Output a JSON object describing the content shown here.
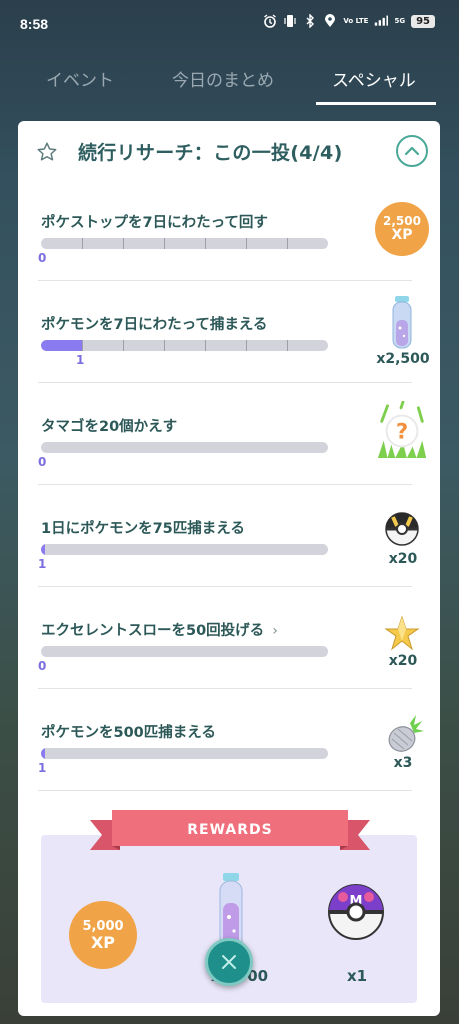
{
  "status_bar": {
    "time": "8:58",
    "battery": "95",
    "network_label": "Vo LTE",
    "signal_label": "5G"
  },
  "tabs": [
    {
      "label": "イベント",
      "active": false
    },
    {
      "label": "今日のまとめ",
      "active": false
    },
    {
      "label": "スペシャル",
      "active": true
    }
  ],
  "card": {
    "title": "続行リサーチ：この一投(4/4)"
  },
  "tasks": [
    {
      "label": "ポケストップを7日にわたって回す",
      "progress": "0",
      "progress_fraction": 0,
      "segments": 7,
      "reward_icon": "xp-badge",
      "reward_xp_value": "2,500",
      "reward_xp_unit": "XP",
      "reward_qty": ""
    },
    {
      "label": "ポケモンを7日にわたって捕まえる",
      "progress": "1",
      "progress_fraction": 0.142857,
      "segments": 7,
      "reward_icon": "stardust-vial-icon",
      "reward_qty": "x2,500"
    },
    {
      "label": "タマゴを20個かえす",
      "progress": "0",
      "progress_fraction": 0,
      "segments": 1,
      "reward_icon": "mystery-encounter-icon",
      "reward_qty": ""
    },
    {
      "label": "1日にポケモンを75匹捕まえる",
      "progress": "1",
      "progress_fraction": 0.0133,
      "segments": 1,
      "reward_icon": "ultra-ball-icon",
      "reward_qty": "x20"
    },
    {
      "label": "エクセレントスローを50回投げる",
      "progress": "0",
      "progress_fraction": 0,
      "segments": 1,
      "reward_icon": "star-piece-icon",
      "reward_qty": "x20",
      "chevron": "›"
    },
    {
      "label": "ポケモンを500匹捕まえる",
      "progress": "1",
      "progress_fraction": 0.002,
      "segments": 1,
      "reward_icon": "silver-pinap-berry-icon",
      "reward_qty": "x3"
    }
  ],
  "rewards": {
    "banner_label": "REWARDS",
    "items": [
      {
        "icon": "xp-badge",
        "xp_value": "5,000",
        "xp_unit": "XP"
      },
      {
        "icon": "stardust-vial-icon",
        "qty": "x2,500"
      },
      {
        "icon": "master-ball-icon",
        "qty": "x1"
      }
    ]
  },
  "colors": {
    "accent_teal": "#2e5e5f",
    "progress_purple": "#8a7cf0",
    "xp_orange": "#f0a347",
    "ribbon_pink": "#ef6f7c"
  }
}
